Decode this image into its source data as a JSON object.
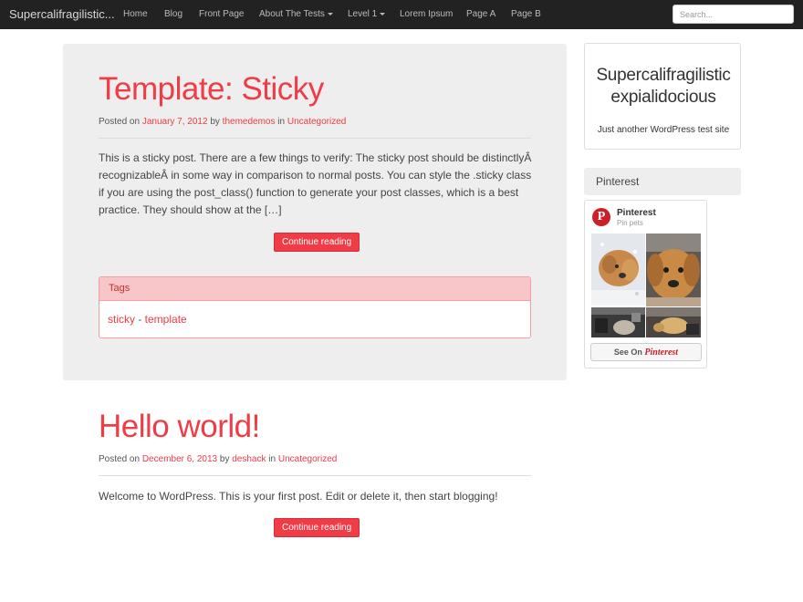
{
  "navbar": {
    "brand": "Supercalifragilistic...",
    "items": [
      {
        "label": "Home",
        "dropdown": false
      },
      {
        "label": "Blog",
        "dropdown": false
      },
      {
        "label": "Front Page",
        "dropdown": false
      },
      {
        "label": "About The Tests",
        "dropdown": true
      },
      {
        "label": "Level 1",
        "dropdown": true
      },
      {
        "label": "Lorem Ipsum",
        "dropdown": false
      },
      {
        "label": "Page A",
        "dropdown": false
      },
      {
        "label": "Page B",
        "dropdown": false
      }
    ],
    "search_placeholder": "Search..."
  },
  "posts": [
    {
      "title": "Template: Sticky",
      "posted_on": "Posted on",
      "date": "January 7, 2012",
      "by": "by",
      "author": "themedemos",
      "in": "in",
      "category": "Uncategorized",
      "excerpt": "This is a sticky post. There are a few things to verify: The sticky post should be distinctlyÂ recognizableÂ in some way in comparison to normal posts. You can style the .sticky class if you are using the post_class() function to generate your post classes, which is a best practice. They should show at the […]",
      "button": "Continue reading",
      "tags_label": "Tags",
      "tags": [
        "sticky",
        "template"
      ],
      "tag_separator": " - "
    },
    {
      "title": "Hello world!",
      "posted_on": "Posted on",
      "date": "December 6, 2013",
      "by": "by",
      "author": "deshack",
      "in": "in",
      "category": "Uncategorized",
      "excerpt": "Welcome to WordPress. This is your first post. Edit or delete it, then start blogging!",
      "button": "Continue reading"
    }
  ],
  "sidebar": {
    "site_name_line1": "Supercalifragilistic",
    "site_name_line2": "expialidocious",
    "site_description": "Just another WordPress test site",
    "pinterest_heading": "Pinterest",
    "pinterest_widget": {
      "name": "Pinterest",
      "board": "Pin pets",
      "see_on": "See On",
      "see_on_brand": "Pinterest"
    }
  },
  "colors": {
    "accent": "#ef3c46",
    "navbar_bg": "#222222",
    "panel_bg": "#eeeeee",
    "tags_header_bg": "#f8c6c8"
  }
}
